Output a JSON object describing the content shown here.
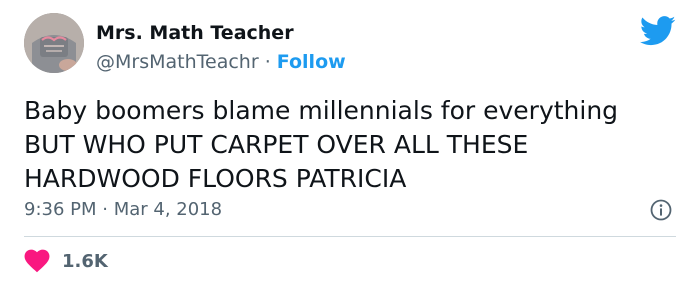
{
  "author": {
    "name": "Mrs. Math Teacher",
    "handle": "@MrsMathTeachr",
    "separator": " · ",
    "follow_label": "Follow"
  },
  "tweet": {
    "lines": [
      "Baby boomers blame millennials for everything",
      "BUT WHO PUT CARPET OVER ALL THESE",
      "HARDWOOD FLOORS PATRICIA"
    ],
    "time": "9:36 PM",
    "separator": " · ",
    "date": "Mar 4, 2018"
  },
  "engagement": {
    "likes": "1.6K"
  },
  "icons": {
    "brand": "twitter-bird-icon",
    "info": "info-icon",
    "like": "heart-icon"
  },
  "colors": {
    "accent": "#1d9bf0",
    "heart": "#f91880",
    "text": "#0f1419",
    "secondary": "#536471"
  }
}
